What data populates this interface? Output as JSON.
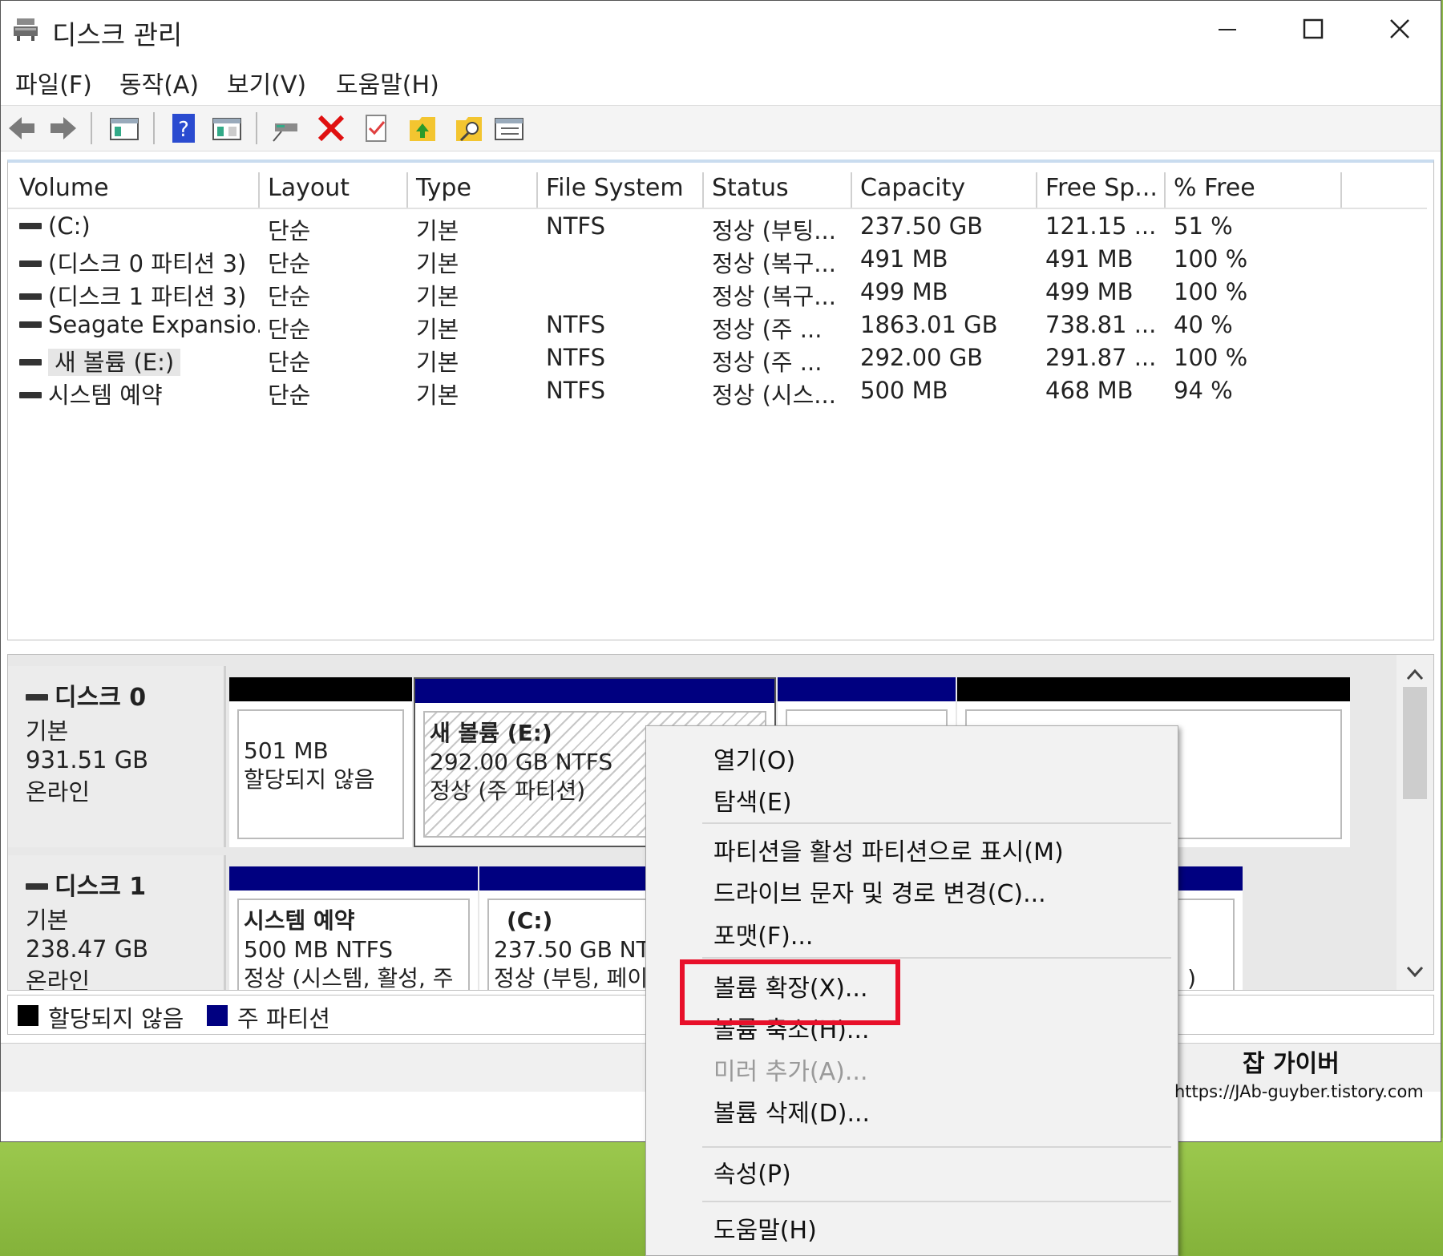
{
  "window": {
    "title": "디스크 관리"
  },
  "menu": [
    "파일(F)",
    "동작(A)",
    "보기(V)",
    "도움말(H)"
  ],
  "toolbar": {
    "icons": [
      "back-icon",
      "forward-icon",
      "console-tree-icon",
      "help-icon",
      "action-pane-icon",
      "connect-icon",
      "delete-icon",
      "properties-icon",
      "up-icon",
      "search-icon",
      "list-icon"
    ]
  },
  "volumes": {
    "columns": [
      "Volume",
      "Layout",
      "Type",
      "File System",
      "Status",
      "Capacity",
      "Free Sp...",
      "% Free"
    ],
    "rows": [
      [
        "(C:)",
        "단순",
        "기본",
        "NTFS",
        "정상 (부팅...",
        "237.50 GB",
        "121.15 ...",
        "51 %"
      ],
      [
        "(디스크 0 파티션 3)",
        "단순",
        "기본",
        "",
        "정상 (복구...",
        "491 MB",
        "491 MB",
        "100 %"
      ],
      [
        "(디스크 1 파티션 3)",
        "단순",
        "기본",
        "",
        "정상 (복구...",
        "499 MB",
        "499 MB",
        "100 %"
      ],
      [
        "Seagate Expansio...",
        "단순",
        "기본",
        "NTFS",
        "정상 (주 ...",
        "1863.01 GB",
        "738.81 ...",
        "40 %"
      ],
      [
        "새 볼륨 (E:)",
        "단순",
        "기본",
        "NTFS",
        "정상 (주 ...",
        "292.00 GB",
        "291.87 ...",
        "100 %"
      ],
      [
        "시스템 예약",
        "단순",
        "기본",
        "NTFS",
        "정상 (시스...",
        "500 MB",
        "468 MB",
        "94 %"
      ]
    ]
  },
  "disks": [
    {
      "name": "디스크 0",
      "type": "기본",
      "size": "931.51 GB",
      "state": "온라인",
      "partitions": [
        {
          "title": "",
          "line1": "501 MB",
          "line2": "할당되지 않음",
          "bar_color": "#000000"
        },
        {
          "title": "새 볼륨  (E:)",
          "line1": "292.00 GB NTFS",
          "line2": "정상 (주 파티션)",
          "bar_color": "#000080"
        },
        {
          "title": "",
          "line1": "",
          "line2": "",
          "bar_color": "#000080"
        },
        {
          "title": "",
          "line1": "",
          "line2": "",
          "bar_color": "#000000"
        }
      ]
    },
    {
      "name": "디스크 1",
      "type": "기본",
      "size": "238.47 GB",
      "state": "온라인",
      "partitions": [
        {
          "title": "시스템 예약",
          "line1": "500 MB NTFS",
          "line2": "정상 (시스템, 활성, 주",
          "bar_color": "#000080"
        },
        {
          "title": "(C:)",
          "line1": "237.50 GB NTF",
          "line2": "정상 (부팅, 페이",
          "bar_color": "#000080"
        },
        {
          "title": "",
          "line1": "",
          "line2": ")",
          "bar_color": "#000080"
        }
      ]
    }
  ],
  "legend": [
    "할당되지 않음",
    "주 파티션"
  ],
  "legend_colors": [
    "#000000",
    "#000080"
  ],
  "context_menu": {
    "items": [
      {
        "label": "열기(O)",
        "enabled": true
      },
      {
        "label": "탐색(E)",
        "enabled": true
      },
      {
        "label": "파티션을 활성 파티션으로 표시(M)",
        "enabled": true
      },
      {
        "label": "드라이브 문자 및 경로 변경(C)...",
        "enabled": true
      },
      {
        "label": "포맷(F)...",
        "enabled": true
      },
      {
        "label": "볼륨 확장(X)...",
        "enabled": true,
        "highlighted": true
      },
      {
        "label": "볼륨 축소(H)...",
        "enabled": true
      },
      {
        "label": "미러 추가(A)...",
        "enabled": false
      },
      {
        "label": "볼륨 삭제(D)...",
        "enabled": true
      },
      {
        "label": "속성(P)",
        "enabled": true
      },
      {
        "label": "도움말(H)",
        "enabled": true
      }
    ]
  },
  "watermark": {
    "name": "잡 가이버",
    "url": "https://JAb-guyber.tistory.com"
  }
}
